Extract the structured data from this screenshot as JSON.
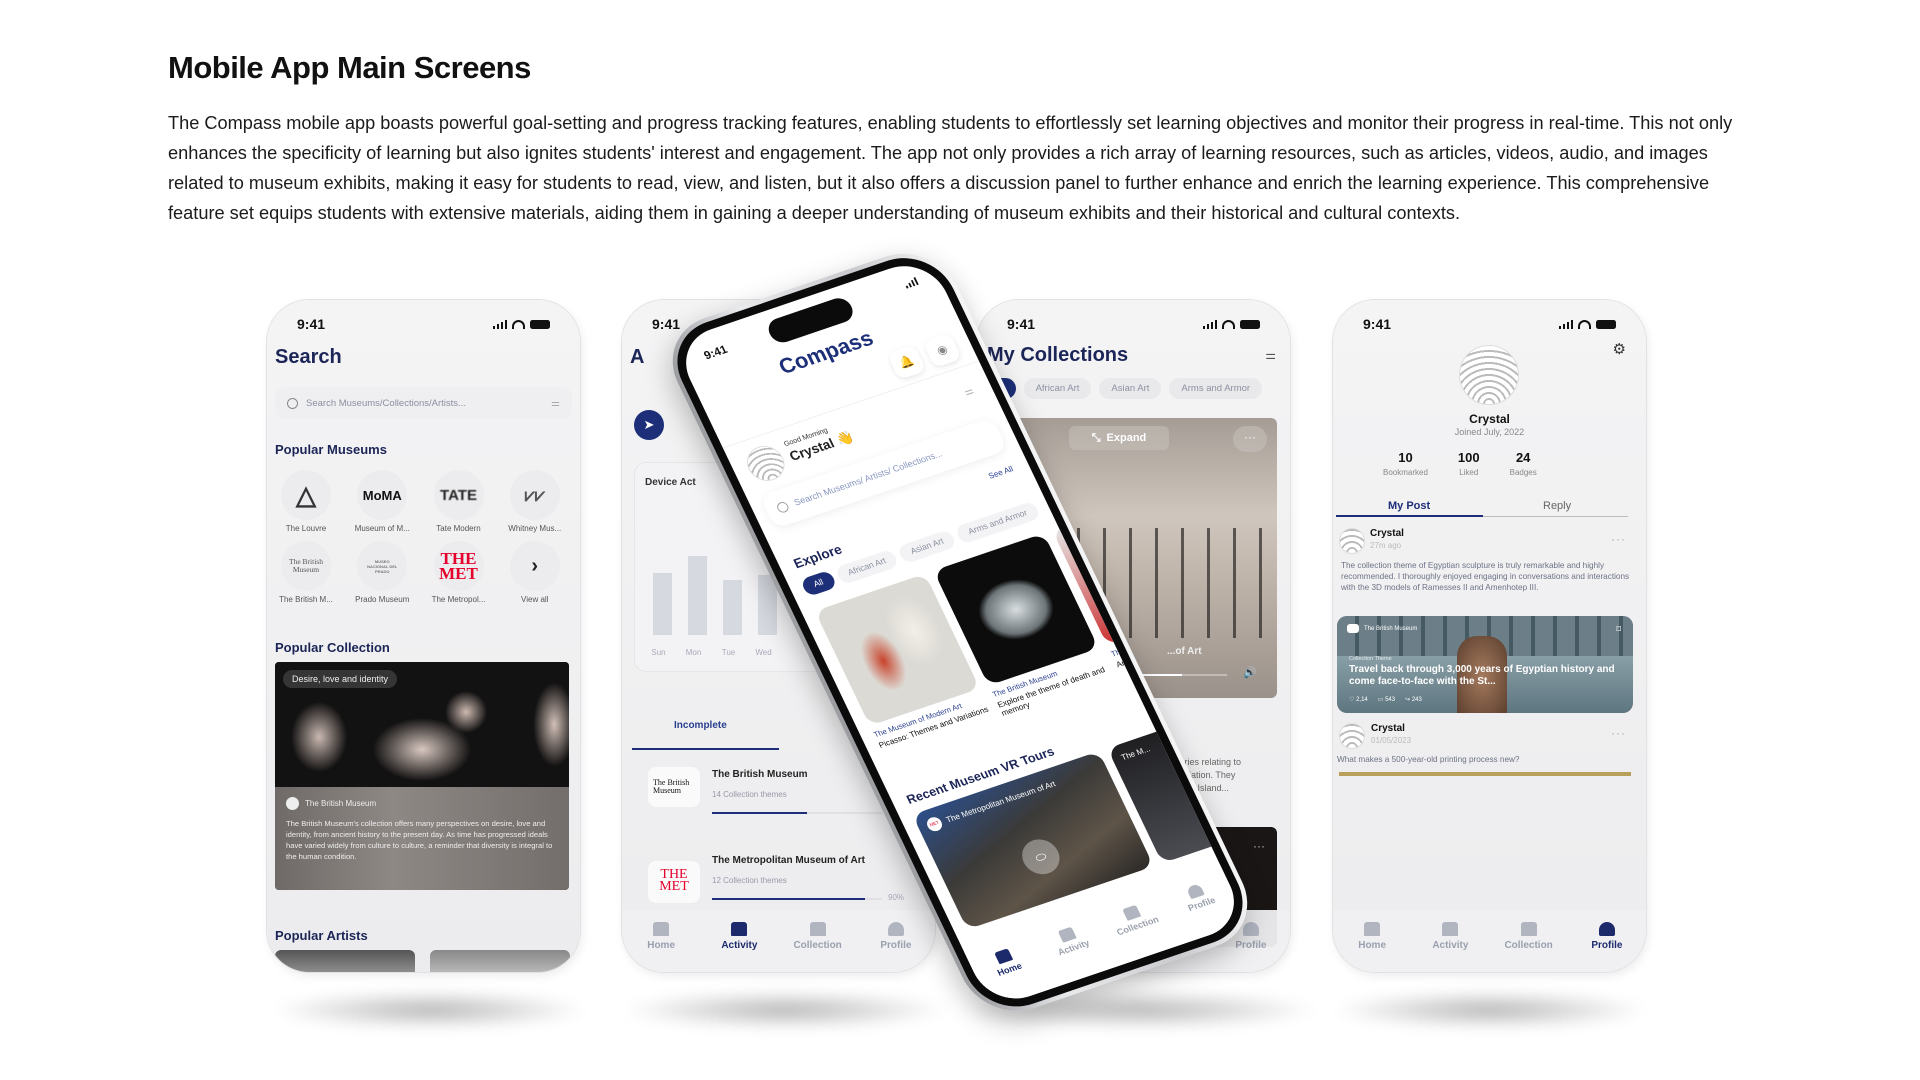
{
  "heading": "Mobile App Main Screens",
  "description": "The Compass mobile app boasts powerful goal-setting and progress tracking features, enabling students to effortlessly set learning objectives and monitor their progress in real-time. This not only enhances the specificity of learning but also ignites students' interest and engagement. The app not only provides a rich array of learning resources, such as articles, videos, audio, and images related to museum exhibits, making it easy for students to read, view, and listen, but it also offers a discussion panel to further enhance and enrich the learning experience. This comprehensive feature set equips students with extensive materials, aiding them in gaining a deeper understanding of museum exhibits and their historical and cultural contexts.",
  "status_time": "9:41",
  "tabs": {
    "home": "Home",
    "activity": "Activity",
    "collection": "Collection",
    "profile": "Profile"
  },
  "search_screen": {
    "title": "Search",
    "search_placeholder": "Search Museums/Collections/Artists...",
    "popular_museums_title": "Popular Museums",
    "museums": [
      {
        "logo": "pyramid",
        "label": "The Louvre"
      },
      {
        "logo": "MoMA",
        "label": "Museum of M..."
      },
      {
        "logo": "TATE",
        "label": "Tate Modern"
      },
      {
        "logo": "whitney",
        "label": "Whitney Mus..."
      },
      {
        "logo": "The British Museum",
        "label": "The British M..."
      },
      {
        "logo": "MUSEO NACIONAL DEL PRADO",
        "label": "Prado Museum"
      },
      {
        "logo": "THE MET",
        "label": "The Metropol..."
      },
      {
        "logo": "chevron-right",
        "label": "View all"
      }
    ],
    "popular_collection_title": "Popular Collection",
    "collection_card": {
      "tag": "Desire, love and identity",
      "museum": "The British Museum",
      "text": "The British Museum's collection offers many perspectives on desire, love and identity, from ancient history to the present day. As time has progressed ideals have varied widely from culture to culture, a reminder that diversity is integral to the human condition."
    },
    "popular_artists_title": "Popular Artists",
    "active_tab": "home"
  },
  "activity_screen": {
    "title_visible": "A",
    "device_activity_visible": "Device Act",
    "bars": [
      {
        "day": "Sun",
        "level": 0.62
      },
      {
        "day": "Mon",
        "level": 0.79
      },
      {
        "day": "Tue",
        "level": 0.55
      },
      {
        "day": "Wed",
        "level": 0.6
      }
    ],
    "tab_incomplete": "Incomplete",
    "items": [
      {
        "name": "The British Museum",
        "sub": "14 Collection themes",
        "progress": 56,
        "progress_label": ""
      },
      {
        "name": "The Metropolitan Museum of Art",
        "sub": "12 Collection themes",
        "progress": 90,
        "progress_label": "90%"
      }
    ],
    "active_tab": "activity"
  },
  "home_screen": {
    "brand": "Compass",
    "greeting": "Good Morning",
    "user": "Crystal",
    "wave_emoji": "👋",
    "search_placeholder": "Search Museums/ Artists/ Collections...",
    "see_all": "See All",
    "explore_title": "Explore",
    "chips": [
      "All",
      "African Art",
      "Asian Art",
      "Arms and Armor"
    ],
    "cards": [
      {
        "museum": "The Museum of Modern Art",
        "title": "Picasso: Themes and Variations"
      },
      {
        "museum": "The British Museum",
        "title": "Explore the theme of death and memory"
      },
      {
        "museum": "The...",
        "title": "Ar... of Art"
      }
    ],
    "vr_title": "Recent Museum VR Tours",
    "vr_tours": [
      {
        "museum": "The Metropolitan Museum of Art"
      },
      {
        "museum": "The M..."
      }
    ],
    "active_tab": "home"
  },
  "collections_screen": {
    "title": "My Collections",
    "chips": [
      "All",
      "African Art",
      "Asian Art",
      "Arms and Armor"
    ],
    "expand_label": "Expand",
    "caption": "...of Art",
    "video_progress": 0.55,
    "desc_lines": [
      "...ories relating to",
      "...nitiation. They",
      "...cific Island..."
    ],
    "active_tab": "collection",
    "tab_collection_visible": "ection"
  },
  "profile_screen": {
    "name": "Crystal",
    "joined": "Joined July, 2022",
    "stats": [
      {
        "value": "10",
        "label": "Bookmarked"
      },
      {
        "value": "100",
        "label": "Liked"
      },
      {
        "value": "24",
        "label": "Badges"
      }
    ],
    "tab_posts": "My Post",
    "tab_reply": "Reply",
    "posts": [
      {
        "author": "Crystal",
        "time": "27m ago",
        "text": "The collection theme of Egyptian sculpture is truly remarkable and highly recommended. I thoroughly enjoyed engaging in conversations and interactions with the 3D models of Ramesses II and Amenhotep III.",
        "card": {
          "museum": "The British Museum",
          "kicker": "Collection Theme",
          "title": "Travel back through 3,000 years of Egyptian history and come face-to-face with the St...",
          "likes": "2,14",
          "comments": "543",
          "shares": "243"
        }
      },
      {
        "author": "Crystal",
        "time": "01/05/2023",
        "text": "What makes a 500-year-old printing process new?"
      }
    ],
    "active_tab": "profile"
  },
  "colors": {
    "navy": "#1c2557",
    "accent": "#1c2f78",
    "met_red": "#e4002b"
  }
}
